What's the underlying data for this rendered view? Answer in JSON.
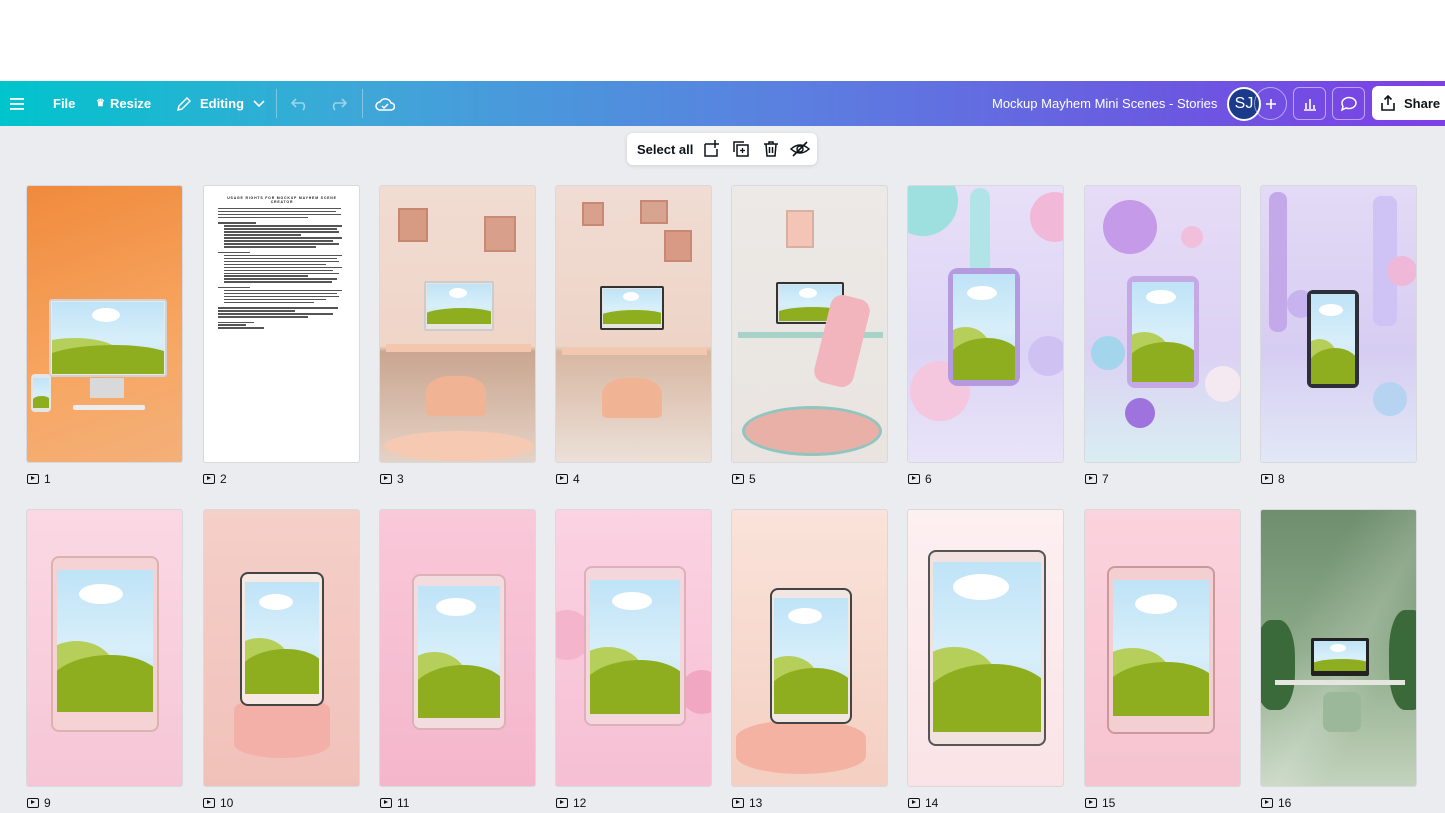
{
  "toolbar": {
    "file_label": "File",
    "resize_label": "Resize",
    "editing_label": "Editing",
    "doc_title": "Mockup Mayhem Mini Scenes - Stories",
    "avatar_initials": "SJ",
    "share_label": "Share"
  },
  "floatbar": {
    "select_all_label": "Select all"
  },
  "document": {
    "heading": "USAGE RIGHTS FOR MOCKUP MAYHEM SCENE CREATOR"
  },
  "pages": [
    {
      "number": "1",
      "theme": "orange-desk"
    },
    {
      "number": "2",
      "theme": "document"
    },
    {
      "number": "3",
      "theme": "peach-desk"
    },
    {
      "number": "4",
      "theme": "peach-desk-2"
    },
    {
      "number": "5",
      "theme": "gaming-chair"
    },
    {
      "number": "6",
      "theme": "pastel-bubbles"
    },
    {
      "number": "7",
      "theme": "pastel-bubbles-2"
    },
    {
      "number": "8",
      "theme": "pastel-bubbles-3"
    },
    {
      "number": "9",
      "theme": "pink-tablet"
    },
    {
      "number": "10",
      "theme": "pink-pedestal"
    },
    {
      "number": "11",
      "theme": "pink-tablet-2"
    },
    {
      "number": "12",
      "theme": "pink-balls"
    },
    {
      "number": "13",
      "theme": "peach-pedestal"
    },
    {
      "number": "14",
      "theme": "pale-pink-tablet"
    },
    {
      "number": "15",
      "theme": "pink-tablet-3"
    },
    {
      "number": "16",
      "theme": "green-desk"
    }
  ],
  "colors": {
    "gradient_start": "#00c4cc",
    "gradient_end": "#7d3fe6",
    "canvas_bg": "#ebecf0",
    "avatar_bg": "#1b3a8c"
  }
}
